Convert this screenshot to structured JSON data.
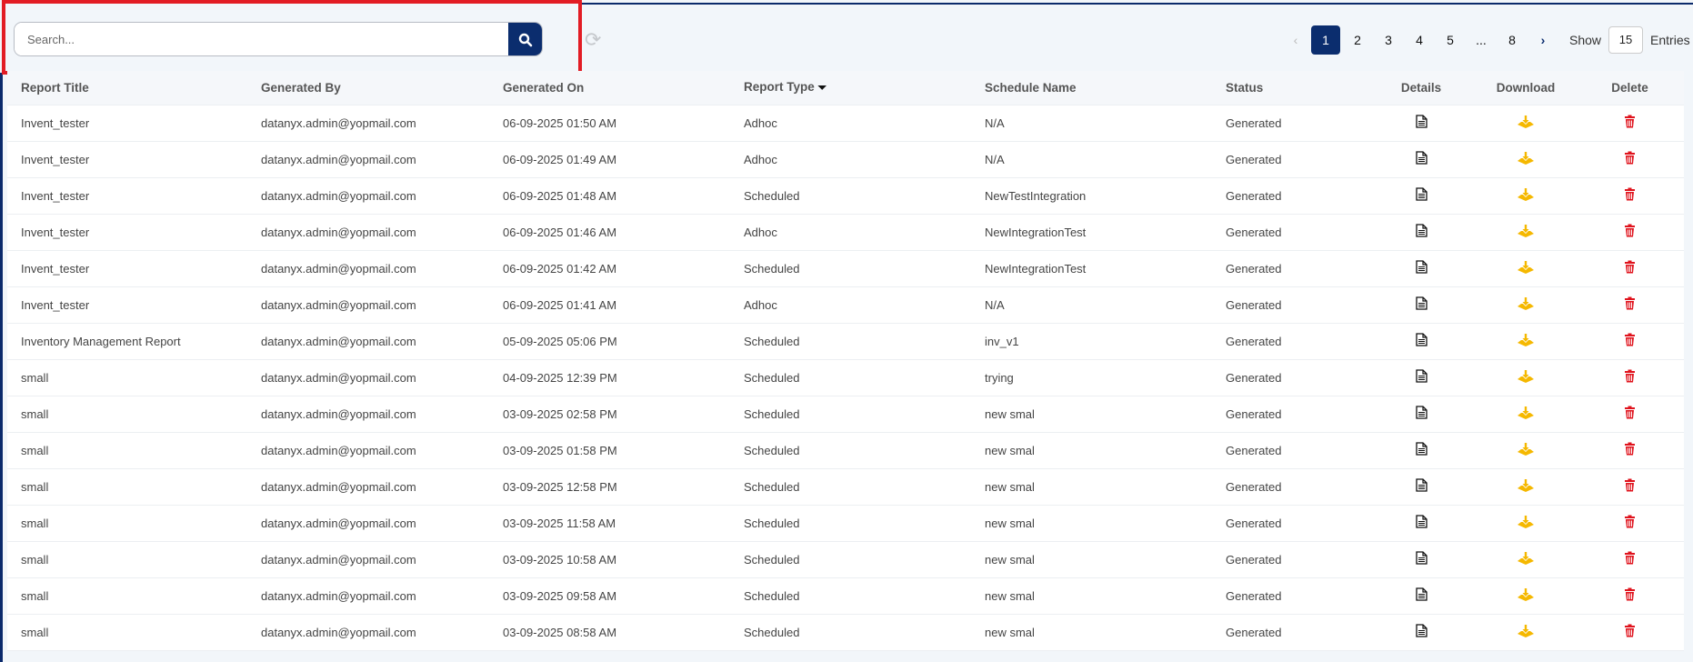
{
  "search": {
    "placeholder": "Search..."
  },
  "pagination": {
    "pages": [
      "1",
      "2",
      "3",
      "4",
      "5",
      "...",
      "8"
    ],
    "current": "1",
    "show_label": "Show",
    "entries_value": "15",
    "entries_label": "Entries"
  },
  "table": {
    "headers": [
      "Report Title",
      "Generated By",
      "Generated On",
      "Report Type",
      "Schedule Name",
      "Status",
      "Details",
      "Download",
      "Delete"
    ],
    "rows": [
      [
        "Invent_tester",
        "datanyx.admin@yopmail.com",
        "06-09-2025 01:50 AM",
        "Adhoc",
        "N/A",
        "Generated"
      ],
      [
        "Invent_tester",
        "datanyx.admin@yopmail.com",
        "06-09-2025 01:49 AM",
        "Adhoc",
        "N/A",
        "Generated"
      ],
      [
        "Invent_tester",
        "datanyx.admin@yopmail.com",
        "06-09-2025 01:48 AM",
        "Scheduled",
        "NewTestIntegration",
        "Generated"
      ],
      [
        "Invent_tester",
        "datanyx.admin@yopmail.com",
        "06-09-2025 01:46 AM",
        "Adhoc",
        "NewIntegrationTest",
        "Generated"
      ],
      [
        "Invent_tester",
        "datanyx.admin@yopmail.com",
        "06-09-2025 01:42 AM",
        "Scheduled",
        "NewIntegrationTest",
        "Generated"
      ],
      [
        "Invent_tester",
        "datanyx.admin@yopmail.com",
        "06-09-2025 01:41 AM",
        "Adhoc",
        "N/A",
        "Generated"
      ],
      [
        "Inventory Management Report",
        "datanyx.admin@yopmail.com",
        "05-09-2025 05:06 PM",
        "Scheduled",
        "inv_v1",
        "Generated"
      ],
      [
        "small",
        "datanyx.admin@yopmail.com",
        "04-09-2025 12:39 PM",
        "Scheduled",
        "trying",
        "Generated"
      ],
      [
        "small",
        "datanyx.admin@yopmail.com",
        "03-09-2025 02:58 PM",
        "Scheduled",
        "new smal",
        "Generated"
      ],
      [
        "small",
        "datanyx.admin@yopmail.com",
        "03-09-2025 01:58 PM",
        "Scheduled",
        "new smal",
        "Generated"
      ],
      [
        "small",
        "datanyx.admin@yopmail.com",
        "03-09-2025 12:58 PM",
        "Scheduled",
        "new smal",
        "Generated"
      ],
      [
        "small",
        "datanyx.admin@yopmail.com",
        "03-09-2025 11:58 AM",
        "Scheduled",
        "new smal",
        "Generated"
      ],
      [
        "small",
        "datanyx.admin@yopmail.com",
        "03-09-2025 10:58 AM",
        "Scheduled",
        "new smal",
        "Generated"
      ],
      [
        "small",
        "datanyx.admin@yopmail.com",
        "03-09-2025 09:58 AM",
        "Scheduled",
        "new smal",
        "Generated"
      ],
      [
        "small",
        "datanyx.admin@yopmail.com",
        "03-09-2025 08:58 AM",
        "Scheduled",
        "new smal",
        "Generated"
      ]
    ]
  },
  "colors": {
    "primary": "#0b2d6e",
    "highlight": "#e21c24",
    "download": "#f5b800",
    "delete": "#e0141e"
  }
}
